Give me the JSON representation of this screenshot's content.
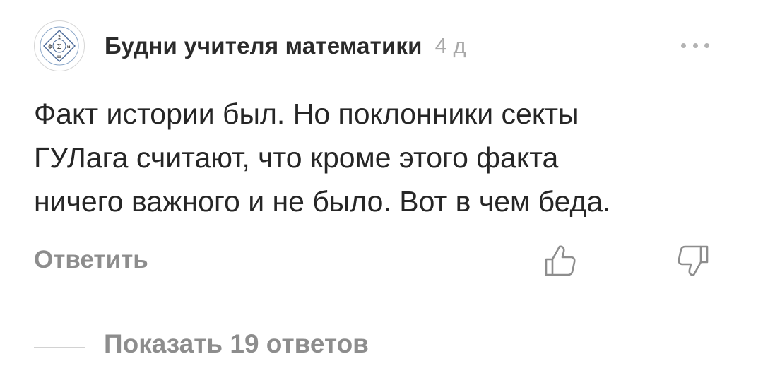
{
  "comment": {
    "author": "Будни учителя математики",
    "time": "4 д",
    "text_lines": [
      "Факт истории был. Но поклонники секты",
      "ГУЛага считают, что кроме этого факта",
      "ничего важного и не было. Вот в чем беда."
    ],
    "reply_label": "Ответить",
    "show_replies_label": "Показать 19 ответов",
    "avatar": {
      "icon": "logo-icon",
      "letters": [
        "2",
        "ф",
        "Σ",
        "м",
        "ш"
      ]
    },
    "icons": {
      "more": "more-dots-icon",
      "like": "thumbs-up-icon",
      "dislike": "thumbs-down-icon"
    }
  },
  "colors": {
    "text": "#262626",
    "muted": "#8d8d8d",
    "time": "#a9a9a9",
    "icon": "#8d8d8d"
  }
}
